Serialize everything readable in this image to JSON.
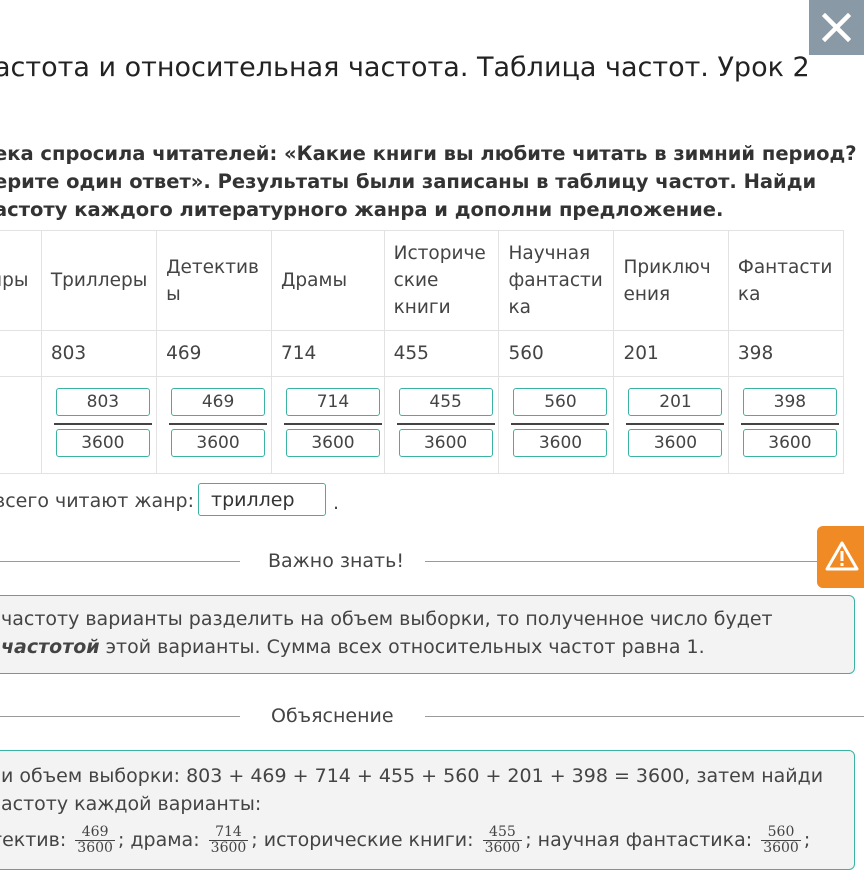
{
  "title": "астота и относительная частота. Таблица частот. Урок 2",
  "task": {
    "line1": "ека спросила читателей: «Какие книги вы любите читать в зимний период?",
    "line2": "ерите один ответ». Результаты были записаны в таблицу частот. Найди",
    "line3": "астоту каждого литературного жанра и дополни предложение."
  },
  "table": {
    "row_header": "нры",
    "columns": [
      {
        "genre": "Триллеры",
        "count": "803",
        "numerator": "803",
        "denominator": "3600"
      },
      {
        "genre": "Детектив ы",
        "count": "469",
        "numerator": "469",
        "denominator": "3600"
      },
      {
        "genre": "Драмы",
        "count": "714",
        "numerator": "714",
        "denominator": "3600"
      },
      {
        "genre": "Историче ские книги",
        "count": "455",
        "numerator": "455",
        "denominator": "3600"
      },
      {
        "genre": "Научная фантасти ка",
        "count": "560",
        "numerator": "560",
        "denominator": "3600"
      },
      {
        "genre": "Приключ ения",
        "count": "201",
        "numerator": "201",
        "denominator": "3600"
      },
      {
        "genre": "Фантасти ка",
        "count": "398",
        "numerator": "398",
        "denominator": "3600"
      }
    ]
  },
  "answer": {
    "label": "всего читают жанр:",
    "value": "триллер",
    "end": "."
  },
  "important": {
    "title": "Важно знать!",
    "line1": " частоту варианты разделить на объем выборки, то полученное число будет",
    "line2_bold": "частотой",
    "line2_rest": " этой варианты. Сумма всех относительных частот равна 1."
  },
  "explanation": {
    "title": "Объяснение",
    "line1": "и объем выборки: 803 + 469 + 714 + 455 + 560 + 201 + 398 = 3600, затем найди",
    "line2": "астоту каждой варианты:",
    "line3_parts": {
      "p1": "тектив:",
      "f1n": "469",
      "f1d": "3600",
      "p2": "; драма:",
      "f2n": "714",
      "f2d": "3600",
      "p3": "; исторические книги:",
      "f3n": "455",
      "f3d": "3600",
      "p4": "; научная фантастика:",
      "f4n": "560",
      "f4d": "3600",
      "p5": ";"
    }
  },
  "icons": {
    "close": "close-icon",
    "warning": "warning-icon"
  },
  "colors": {
    "accent_teal": "#3bb3a2",
    "warning_orange": "#f08a24",
    "close_gray": "#8a99a6"
  }
}
